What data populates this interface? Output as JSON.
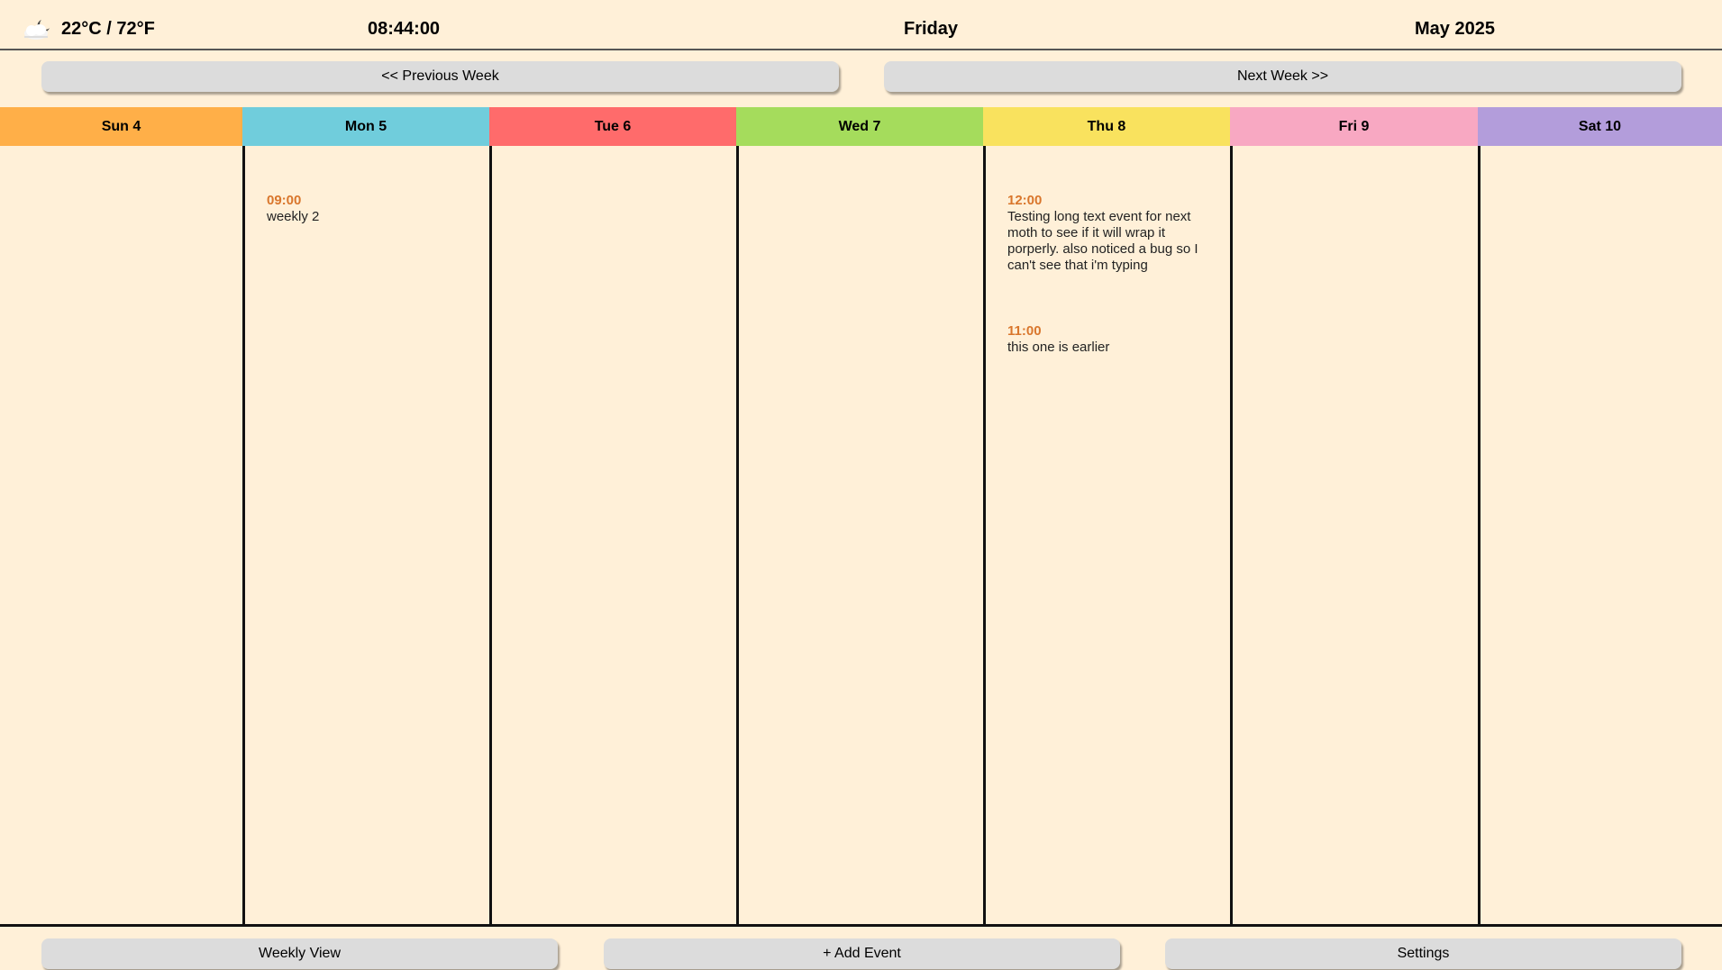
{
  "header": {
    "weather": "22°C / 72°F",
    "weather_icon": "partly-cloudy-night-icon",
    "time": "08:44:00",
    "day": "Friday",
    "month_year": "May 2025"
  },
  "nav": {
    "prev_label": "<< Previous Week",
    "next_label": "Next Week >>"
  },
  "days": [
    {
      "label": "Sun 4",
      "color": "#FFAF48",
      "events": []
    },
    {
      "label": "Mon 5",
      "color": "#70CDDC",
      "events": [
        {
          "time": "09:00",
          "text": "weekly 2"
        }
      ]
    },
    {
      "label": "Tue 6",
      "color": "#FF6B6B",
      "events": []
    },
    {
      "label": "Wed 7",
      "color": "#A5DC5C",
      "events": []
    },
    {
      "label": "Thu 8",
      "color": "#F9E25E",
      "events": [
        {
          "time": "12:00",
          "text": "Testing long text event for  next moth to see if it will wrap it porperly. also noticed a bug so I can't see that i'm typing"
        },
        {
          "time": "11:00",
          "text": "this one is earlier"
        }
      ]
    },
    {
      "label": "Fri 9",
      "color": "#F8A8C2",
      "events": []
    },
    {
      "label": "Sat 10",
      "color": "#B39DDB",
      "events": []
    }
  ],
  "footer": {
    "weekly_label": "Weekly View",
    "add_label": "+ Add Event",
    "settings_label": "Settings"
  },
  "colors": {
    "background": "#FFF0D8",
    "event_time": "#D9762C",
    "button": "#DCDCDC"
  }
}
